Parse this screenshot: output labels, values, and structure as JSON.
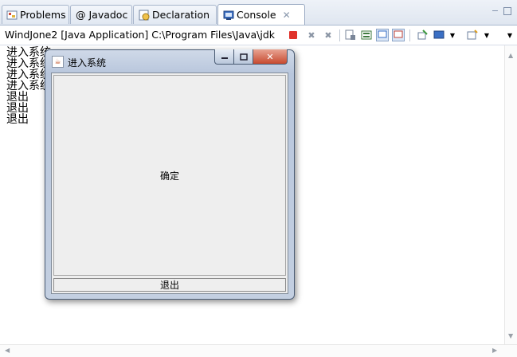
{
  "tabs": [
    {
      "label": "Problems",
      "icon": "problems-icon"
    },
    {
      "label": "@ Javadoc",
      "icon": "javadoc-icon"
    },
    {
      "label": "Declaration",
      "icon": "declaration-icon"
    },
    {
      "label": "Console",
      "icon": "console-icon",
      "active": true
    }
  ],
  "console": {
    "title": "WindJone2 [Java Application] C:\\Program Files\\Java\\jdk",
    "lines": [
      "进入系统",
      "进入系统",
      "进入系统",
      "进入系统",
      "退出",
      "退出",
      "退出"
    ]
  },
  "dialog": {
    "title": "进入系统",
    "ok_label": "确定",
    "exit_label": "退出"
  },
  "colors": {
    "terminate_red": "#e0322b",
    "tab_border": "#a8b6cc",
    "close_button": "#c74a2f"
  }
}
